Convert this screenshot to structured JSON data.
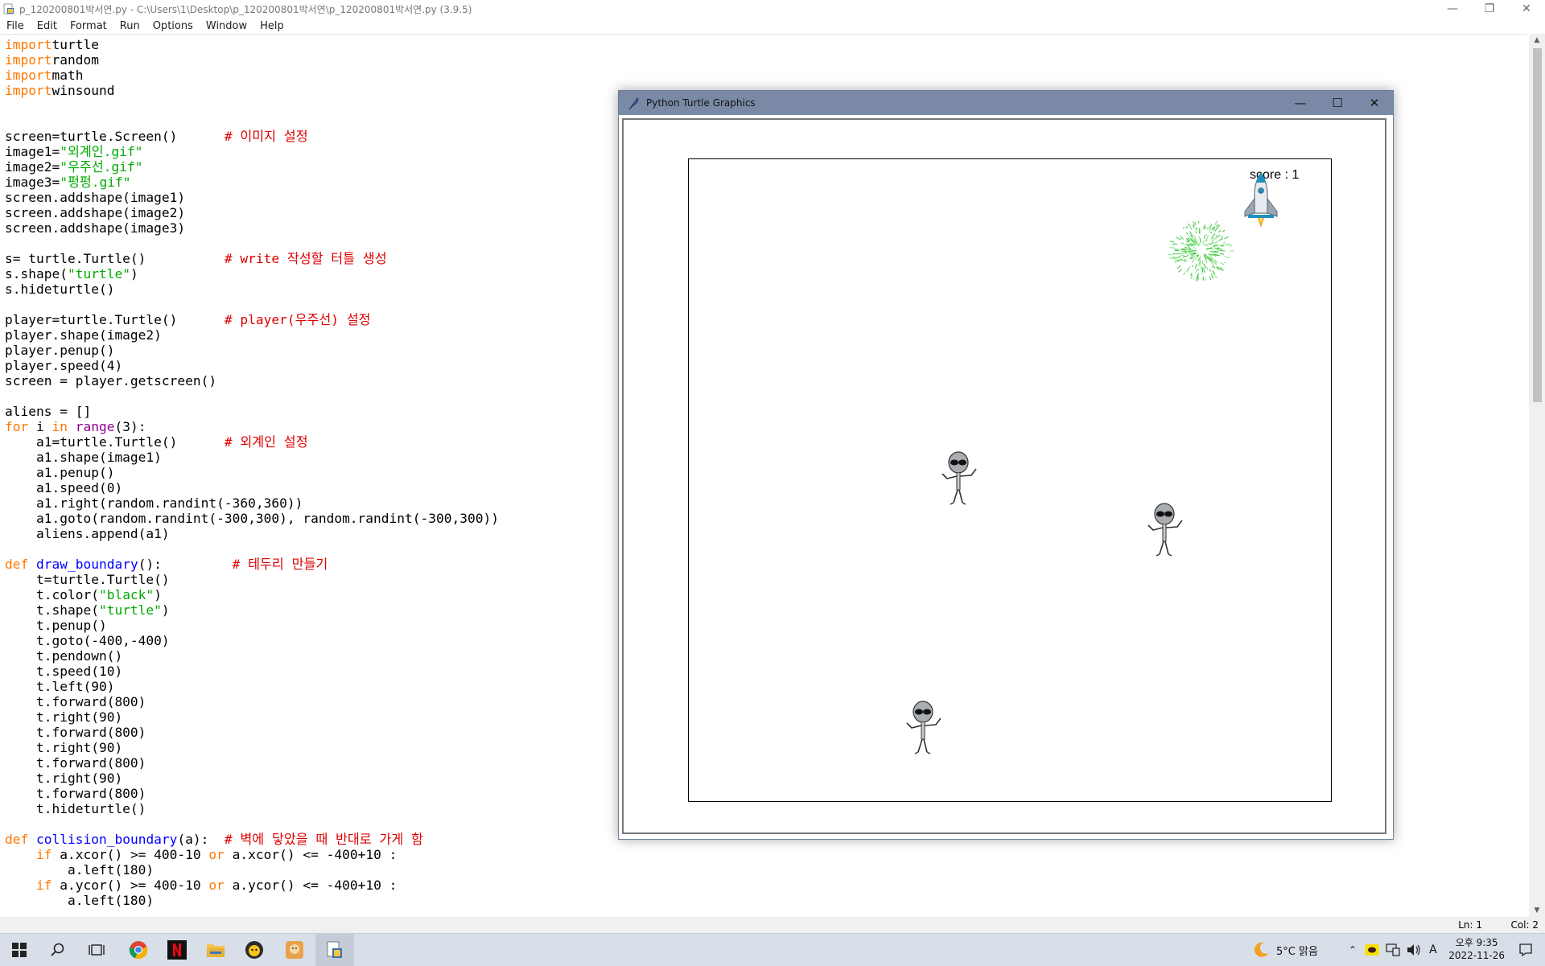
{
  "idle": {
    "title": "p_120200801박서연.py - C:\\Users\\1\\Desktop\\p_120200801박서연\\p_120200801박서연.py (3.9.5)",
    "menu": [
      "File",
      "Edit",
      "Format",
      "Run",
      "Options",
      "Window",
      "Help"
    ],
    "status": {
      "ln": "Ln: 1",
      "col": "Col: 2"
    }
  },
  "code": {
    "lines": [
      [
        [
          "kw",
          "import"
        ],
        [
          "",
          "turtle"
        ]
      ],
      [
        [
          "kw",
          "import"
        ],
        [
          "",
          "random"
        ]
      ],
      [
        [
          "kw",
          "import"
        ],
        [
          "",
          "math"
        ]
      ],
      [
        [
          "kw",
          "import"
        ],
        [
          "",
          "winsound"
        ]
      ],
      [],
      [],
      [
        [
          "",
          "screen=turtle.Screen()      "
        ],
        [
          "cm",
          "# 이미지 설정"
        ]
      ],
      [
        [
          "",
          "image1="
        ],
        [
          "st",
          "\"외계인.gif\""
        ]
      ],
      [
        [
          "",
          "image2="
        ],
        [
          "st",
          "\"우주선.gif\""
        ]
      ],
      [
        [
          "",
          "image3="
        ],
        [
          "st",
          "\"펑펑.gif\""
        ]
      ],
      [
        [
          "",
          "screen.addshape(image1)"
        ]
      ],
      [
        [
          "",
          "screen.addshape(image2)"
        ]
      ],
      [
        [
          "",
          "screen.addshape(image3)"
        ]
      ],
      [],
      [
        [
          "",
          "s= turtle.Turtle()          "
        ],
        [
          "cm",
          "# write 작성할 터틀 생성"
        ]
      ],
      [
        [
          "",
          "s.shape("
        ],
        [
          "st",
          "\"turtle\""
        ],
        [
          "",
          ")"
        ]
      ],
      [
        [
          "",
          "s.hideturtle()"
        ]
      ],
      [],
      [
        [
          "",
          "player=turtle.Turtle()      "
        ],
        [
          "cm",
          "# player(우주선) 설정"
        ]
      ],
      [
        [
          "",
          "player.shape(image2)"
        ]
      ],
      [
        [
          "",
          "player.penup()"
        ]
      ],
      [
        [
          "",
          "player.speed(4)"
        ]
      ],
      [
        [
          "",
          "screen = player.getscreen()"
        ]
      ],
      [],
      [
        [
          "",
          "aliens = []"
        ]
      ],
      [
        [
          "kw",
          "for"
        ],
        [
          "",
          " i "
        ],
        [
          "kw",
          "in"
        ],
        [
          "",
          " "
        ],
        [
          "bi",
          "range"
        ],
        [
          "",
          "(3):"
        ]
      ],
      [
        [
          "",
          "    a1=turtle.Turtle()      "
        ],
        [
          "cm",
          "# 외계인 설정"
        ]
      ],
      [
        [
          "",
          "    a1.shape(image1)"
        ]
      ],
      [
        [
          "",
          "    a1.penup()"
        ]
      ],
      [
        [
          "",
          "    a1.speed(0)"
        ]
      ],
      [
        [
          "",
          "    a1.right(random.randint(-360,360))"
        ]
      ],
      [
        [
          "",
          "    a1.goto(random.randint(-300,300), random.randint(-300,300))"
        ]
      ],
      [
        [
          "",
          "    aliens.append(a1)"
        ]
      ],
      [],
      [
        [
          "kw",
          "def"
        ],
        [
          "",
          " "
        ],
        [
          "df",
          "draw_boundary"
        ],
        [
          "",
          "():         "
        ],
        [
          "cm",
          "# 테두리 만들기"
        ]
      ],
      [
        [
          "",
          "    t=turtle.Turtle()"
        ]
      ],
      [
        [
          "",
          "    t.color("
        ],
        [
          "st",
          "\"black\""
        ],
        [
          "",
          ")"
        ]
      ],
      [
        [
          "",
          "    t.shape("
        ],
        [
          "st",
          "\"turtle\""
        ],
        [
          "",
          ")"
        ]
      ],
      [
        [
          "",
          "    t.penup()"
        ]
      ],
      [
        [
          "",
          "    t.goto(-400,-400)"
        ]
      ],
      [
        [
          "",
          "    t.pendown()"
        ]
      ],
      [
        [
          "",
          "    t.speed(10)"
        ]
      ],
      [
        [
          "",
          "    t.left(90)"
        ]
      ],
      [
        [
          "",
          "    t.forward(800)"
        ]
      ],
      [
        [
          "",
          "    t.right(90)"
        ]
      ],
      [
        [
          "",
          "    t.forward(800)"
        ]
      ],
      [
        [
          "",
          "    t.right(90)"
        ]
      ],
      [
        [
          "",
          "    t.forward(800)"
        ]
      ],
      [
        [
          "",
          "    t.right(90)"
        ]
      ],
      [
        [
          "",
          "    t.forward(800)"
        ]
      ],
      [
        [
          "",
          "    t.hideturtle()"
        ]
      ],
      [],
      [
        [
          "kw",
          "def"
        ],
        [
          "",
          " "
        ],
        [
          "df",
          "collision_boundary"
        ],
        [
          "",
          "(a):  "
        ],
        [
          "cm",
          "# 벽에 닿았을 때 반대로 가게 함"
        ]
      ],
      [
        [
          "",
          "    "
        ],
        [
          "kw",
          "if"
        ],
        [
          "",
          " a.xcor() >= 400-10 "
        ],
        [
          "kw",
          "or"
        ],
        [
          "",
          " a.xcor() <= -400+10 :"
        ]
      ],
      [
        [
          "",
          "        a.left(180)"
        ]
      ],
      [
        [
          "",
          "    "
        ],
        [
          "kw",
          "if"
        ],
        [
          "",
          " a.ycor() >= 400-10 "
        ],
        [
          "kw",
          "or"
        ],
        [
          "",
          " a.ycor() <= -400+10 :"
        ]
      ],
      [
        [
          "",
          "        a.left(180)"
        ]
      ]
    ]
  },
  "turtle_window": {
    "title": "Python Turtle Graphics",
    "score_text": "score : 1"
  },
  "taskbar": {
    "weather": "5°C  맑음",
    "ime": "A",
    "time": "오후 9:35",
    "date": "2022-11-26"
  }
}
